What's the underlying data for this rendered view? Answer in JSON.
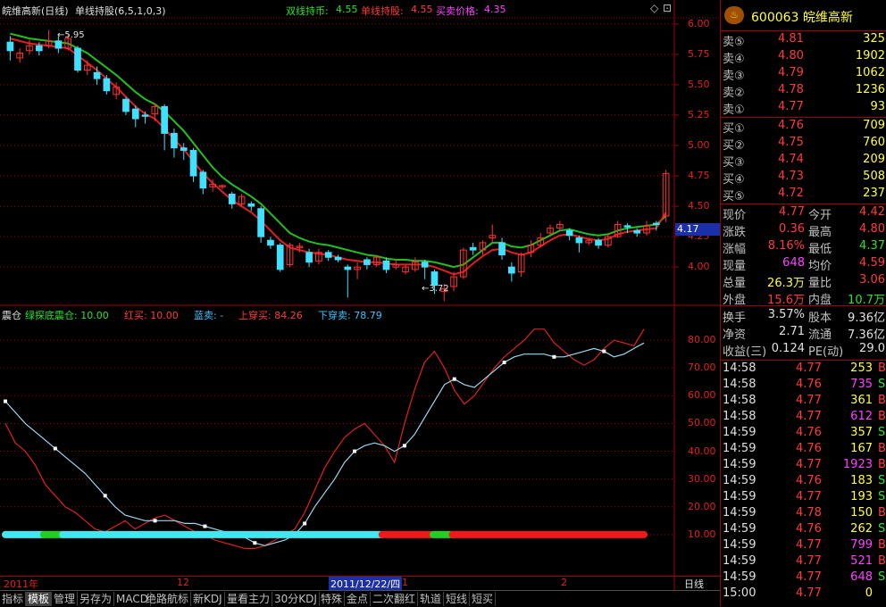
{
  "header": {
    "title": "皖维高新(日线)",
    "formula": "单线持股(6,5,1,0,3)",
    "stat1_label": "双线持币:",
    "stat1_value": "4.55",
    "stat2_label": "单线持股:",
    "stat2_value": "4.55",
    "stat3_label": "买卖价格:",
    "stat3_value": "4.35"
  },
  "price_axis": [
    "6.00",
    "5.75",
    "5.50",
    "5.25",
    "5.00",
    "4.75",
    "4.50",
    "4.25",
    "4.00"
  ],
  "price_marker": "4.17",
  "annotations": {
    "high": "5.95",
    "low": "3.72"
  },
  "indicator": {
    "name": "震仓",
    "items": [
      {
        "label": "绿探底震仓:",
        "value": "10.00",
        "color": "#2ee02e"
      },
      {
        "label": "红买:",
        "value": "10.00",
        "color": "#ff3a3a"
      },
      {
        "label": "蓝卖:",
        "value": "-",
        "color": "#40c0ff"
      },
      {
        "label": "上穿买:",
        "value": "84.26",
        "color": "#ff3a3a"
      },
      {
        "label": "下穿卖:",
        "value": "78.79",
        "color": "#40c0ff"
      }
    ],
    "axis": [
      "80.00",
      "70.00",
      "60.00",
      "50.00",
      "40.00",
      "30.00",
      "20.00",
      "10.00"
    ]
  },
  "datebar": {
    "year": "2011年",
    "m12": "12",
    "cursor_date": "2011/12/22/四",
    "m1": "1",
    "m2": "2",
    "period": "日线"
  },
  "tabs": [
    "指标",
    "模板",
    "管理",
    "另存为",
    "MACD",
    "绝路航标",
    "新KDJ",
    "量看主力",
    "30分KDJ",
    "特殊",
    "金点",
    "二次翻红",
    "轨道",
    "短线",
    "短买"
  ],
  "quote": {
    "code_name": "600063 皖维高新",
    "asks": [
      {
        "label": "卖⑤",
        "price": "4.81",
        "vol": "325"
      },
      {
        "label": "卖④",
        "price": "4.80",
        "vol": "1902"
      },
      {
        "label": "卖③",
        "price": "4.79",
        "vol": "1062"
      },
      {
        "label": "卖②",
        "price": "4.78",
        "vol": "1236"
      },
      {
        "label": "卖①",
        "price": "4.77",
        "vol": "93"
      }
    ],
    "bids": [
      {
        "label": "买①",
        "price": "4.76",
        "vol": "709"
      },
      {
        "label": "买②",
        "price": "4.75",
        "vol": "760"
      },
      {
        "label": "买③",
        "price": "4.74",
        "vol": "209"
      },
      {
        "label": "买④",
        "price": "4.73",
        "vol": "508"
      },
      {
        "label": "买⑤",
        "price": "4.72",
        "vol": "237"
      }
    ],
    "stats": [
      {
        "l1": "现价",
        "v1": "4.77",
        "c1": "red",
        "l2": "今开",
        "v2": "4.42",
        "c2": "red"
      },
      {
        "l1": "涨跌",
        "v1": "0.36",
        "c1": "red",
        "l2": "最高",
        "v2": "4.80",
        "c2": "red"
      },
      {
        "l1": "涨幅",
        "v1": "8.16%",
        "c1": "red",
        "l2": "最低",
        "v2": "4.37",
        "c2": "grn"
      },
      {
        "l1": "现量",
        "v1": "648",
        "c1": "mag",
        "l2": "均价",
        "v2": "4.59",
        "c2": "red"
      },
      {
        "l1": "总量",
        "v1": "26.3万",
        "c1": "yel",
        "l2": "量比",
        "v2": "3.06",
        "c2": "red"
      },
      {
        "l1": "外盘",
        "v1": "15.6万",
        "c1": "red",
        "l2": "内盘",
        "v2": "10.7万",
        "c2": "grn"
      }
    ],
    "stats2": [
      {
        "l1": "换手",
        "v1": "3.57%",
        "c1": "wht",
        "l2": "股本",
        "v2": "9.36亿",
        "c2": "wht"
      },
      {
        "l1": "净资",
        "v1": "2.71",
        "c1": "wht",
        "l2": "流通",
        "v2": "7.36亿",
        "c2": "wht"
      },
      {
        "l1": "收益(三)",
        "v1": "0.124",
        "c1": "wht",
        "l2": "PE(动)",
        "v2": "29.0",
        "c2": "wht"
      }
    ],
    "ticks": [
      {
        "t": "14:58",
        "p": "4.77",
        "v": "253",
        "s": "B",
        "vc": "yel"
      },
      {
        "t": "14:58",
        "p": "4.76",
        "v": "735",
        "s": "S",
        "vc": "mag"
      },
      {
        "t": "14:58",
        "p": "4.77",
        "v": "361",
        "s": "B",
        "vc": "yel"
      },
      {
        "t": "14:58",
        "p": "4.77",
        "v": "612",
        "s": "B",
        "vc": "mag"
      },
      {
        "t": "14:59",
        "p": "4.76",
        "v": "357",
        "s": "S",
        "vc": "yel"
      },
      {
        "t": "14:59",
        "p": "4.76",
        "v": "167",
        "s": "B",
        "vc": "yel"
      },
      {
        "t": "14:59",
        "p": "4.77",
        "v": "1923",
        "s": "B",
        "vc": "mag"
      },
      {
        "t": "14:59",
        "p": "4.76",
        "v": "183",
        "s": "S",
        "vc": "yel"
      },
      {
        "t": "14:59",
        "p": "4.77",
        "v": "193",
        "s": "S",
        "vc": "yel"
      },
      {
        "t": "14:59",
        "p": "4.78",
        "v": "150",
        "s": "B",
        "vc": "yel"
      },
      {
        "t": "14:59",
        "p": "4.76",
        "v": "262",
        "s": "S",
        "vc": "yel"
      },
      {
        "t": "14:59",
        "p": "4.77",
        "v": "799",
        "s": "B",
        "vc": "mag"
      },
      {
        "t": "14:59",
        "p": "4.77",
        "v": "521",
        "s": "B",
        "vc": "mag"
      },
      {
        "t": "14:59",
        "p": "4.77",
        "v": "648",
        "s": "S",
        "vc": "mag"
      },
      {
        "t": "15:00",
        "p": "4.77",
        "v": "0",
        "s": "",
        "vc": "yel"
      }
    ]
  },
  "colors": {
    "up": "#ff3030",
    "down": "#40e0ff",
    "grid": "#a00000",
    "ma_green": "#20c020",
    "ma_red": "#e02020"
  },
  "chart_data": {
    "type": "candlestick",
    "ylim": [
      3.7,
      6.05
    ],
    "candles": [
      [
        5.85,
        5.78,
        5.9,
        5.7
      ],
      [
        5.72,
        5.76,
        5.8,
        5.68
      ],
      [
        5.78,
        5.82,
        5.87,
        5.75
      ],
      [
        5.82,
        5.78,
        5.85,
        5.74
      ],
      [
        5.82,
        5.86,
        5.95,
        5.8
      ],
      [
        5.86,
        5.8,
        5.9,
        5.76
      ],
      [
        5.8,
        5.88,
        5.92,
        5.78
      ],
      [
        5.8,
        5.62,
        5.82,
        5.6
      ],
      [
        5.62,
        5.66,
        5.7,
        5.58
      ],
      [
        5.6,
        5.55,
        5.65,
        5.5
      ],
      [
        5.55,
        5.45,
        5.58,
        5.42
      ],
      [
        5.42,
        5.48,
        5.52,
        5.38
      ],
      [
        5.38,
        5.28,
        5.4,
        5.25
      ],
      [
        5.3,
        5.22,
        5.33,
        5.15
      ],
      [
        5.25,
        5.24,
        5.28,
        5.18
      ],
      [
        5.26,
        5.32,
        5.35,
        5.2
      ],
      [
        5.32,
        5.1,
        5.34,
        4.96
      ],
      [
        5.1,
        4.98,
        5.14,
        4.9
      ],
      [
        4.98,
        4.96,
        5.02,
        4.88
      ],
      [
        4.96,
        4.75,
        4.98,
        4.7
      ],
      [
        4.78,
        4.65,
        4.8,
        4.6
      ],
      [
        4.66,
        4.68,
        4.72,
        4.62
      ],
      [
        4.66,
        4.67,
        4.68,
        4.64
      ],
      [
        4.6,
        4.52,
        4.62,
        4.48
      ],
      [
        4.52,
        4.58,
        4.6,
        4.5
      ],
      [
        4.52,
        4.5,
        4.54,
        4.46
      ],
      [
        4.48,
        4.25,
        4.5,
        4.2
      ],
      [
        4.22,
        4.18,
        4.25,
        4.15
      ],
      [
        4.18,
        3.98,
        4.2,
        3.96
      ],
      [
        4.02,
        4.18,
        4.2,
        4.0
      ],
      [
        4.16,
        4.17,
        4.2,
        4.12
      ],
      [
        4.12,
        4.04,
        4.15,
        4.0
      ],
      [
        4.05,
        4.12,
        4.15,
        4.02
      ],
      [
        4.12,
        4.08,
        4.14,
        4.05
      ],
      [
        4.08,
        4.06,
        4.1,
        4.04
      ],
      [
        4.0,
        3.98,
        4.02,
        3.75
      ],
      [
        3.98,
        4.0,
        4.04,
        3.9
      ],
      [
        4.06,
        4.02,
        4.08,
        3.98
      ],
      [
        4.02,
        4.08,
        4.1,
        4.0
      ],
      [
        4.05,
        3.98,
        4.08,
        3.95
      ],
      [
        4.0,
        4.02,
        4.06,
        3.98
      ],
      [
        3.96,
        4.0,
        4.02,
        3.94
      ],
      [
        3.98,
        4.04,
        4.08,
        3.96
      ],
      [
        4.04,
        4.0,
        4.06,
        3.9
      ],
      [
        3.96,
        3.85,
        3.98,
        3.78
      ],
      [
        3.8,
        3.82,
        3.86,
        3.72
      ],
      [
        3.84,
        3.92,
        3.96,
        3.8
      ],
      [
        3.92,
        4.14,
        4.16,
        3.9
      ],
      [
        4.16,
        4.14,
        4.2,
        4.1
      ],
      [
        4.14,
        4.2,
        4.22,
        4.1
      ],
      [
        4.24,
        4.26,
        4.35,
        4.2
      ],
      [
        4.2,
        4.1,
        4.24,
        4.06
      ],
      [
        4.0,
        3.95,
        4.04,
        3.88
      ],
      [
        3.96,
        4.1,
        4.12,
        3.92
      ],
      [
        4.12,
        4.18,
        4.22,
        4.08
      ],
      [
        4.18,
        4.24,
        4.28,
        4.16
      ],
      [
        4.28,
        4.32,
        4.35,
        4.26
      ],
      [
        4.32,
        4.35,
        4.38,
        4.3
      ],
      [
        4.3,
        4.26,
        4.32,
        4.22
      ],
      [
        4.24,
        4.2,
        4.26,
        4.12
      ],
      [
        4.2,
        4.22,
        4.24,
        4.18
      ],
      [
        4.22,
        4.18,
        4.24,
        4.15
      ],
      [
        4.18,
        4.25,
        4.28,
        4.16
      ],
      [
        4.25,
        4.35,
        4.38,
        4.24
      ],
      [
        4.34,
        4.33,
        4.36,
        4.28
      ],
      [
        4.3,
        4.28,
        4.32,
        4.25
      ],
      [
        4.28,
        4.34,
        4.38,
        4.26
      ],
      [
        4.36,
        4.35,
        4.38,
        4.3
      ],
      [
        4.42,
        4.77,
        4.8,
        4.37
      ]
    ],
    "ma_green": [
      5.92,
      5.9,
      5.88,
      5.87,
      5.86,
      5.85,
      5.84,
      5.8,
      5.76,
      5.7,
      5.64,
      5.58,
      5.51,
      5.44,
      5.38,
      5.34,
      5.28,
      5.2,
      5.12,
      5.02,
      4.92,
      4.82,
      4.74,
      4.68,
      4.63,
      4.58,
      4.52,
      4.44,
      4.36,
      4.28,
      4.24,
      4.21,
      4.19,
      4.18,
      4.16,
      4.14,
      4.12,
      4.1,
      4.09,
      4.07,
      4.06,
      4.06,
      4.05,
      4.05,
      4.04,
      4.02,
      4.0,
      4.02,
      4.08,
      4.14,
      4.2,
      4.2,
      4.17,
      4.16,
      4.18,
      4.22,
      4.26,
      4.3,
      4.31,
      4.29,
      4.27,
      4.26,
      4.27,
      4.3,
      4.32,
      4.33,
      4.34,
      4.35,
      4.42
    ],
    "ma_red": [
      5.88,
      5.86,
      5.84,
      5.83,
      5.82,
      5.81,
      5.8,
      5.74,
      5.68,
      5.62,
      5.55,
      5.48,
      5.4,
      5.32,
      5.26,
      5.22,
      5.14,
      5.05,
      4.97,
      4.87,
      4.77,
      4.69,
      4.62,
      4.55,
      4.5,
      4.45,
      4.38,
      4.3,
      4.22,
      4.16,
      4.14,
      4.12,
      4.11,
      4.1,
      4.08,
      4.06,
      4.05,
      4.04,
      4.04,
      4.03,
      4.02,
      4.02,
      4.02,
      4.02,
      4.0,
      3.97,
      3.94,
      3.96,
      4.03,
      4.09,
      4.14,
      4.15,
      4.12,
      4.1,
      4.12,
      4.17,
      4.22,
      4.26,
      4.27,
      4.25,
      4.23,
      4.22,
      4.23,
      4.27,
      4.29,
      4.3,
      4.31,
      4.32,
      4.45
    ],
    "ind_red": [
      50,
      43,
      40,
      35,
      28,
      24,
      20,
      18,
      15,
      12,
      11,
      13,
      15,
      12,
      14,
      16,
      17,
      15,
      13,
      11,
      10,
      8,
      7,
      6,
      5,
      5,
      6,
      8,
      10,
      12,
      18,
      26,
      34,
      40,
      45,
      48,
      50,
      46,
      42,
      36,
      50,
      62,
      72,
      76,
      70,
      62,
      57,
      60,
      65,
      70,
      74,
      77,
      80,
      84,
      84,
      79,
      76,
      73,
      71,
      73,
      77,
      80,
      79,
      78,
      84
    ],
    "ind_blue": [
      58,
      54,
      50,
      47,
      44,
      41,
      38,
      35,
      32,
      28,
      24,
      20,
      17,
      16,
      15,
      15,
      15,
      15,
      14,
      14,
      13,
      12,
      11,
      10,
      9,
      7,
      6,
      7,
      8,
      10,
      14,
      20,
      25,
      30,
      36,
      40,
      42,
      43,
      42,
      40,
      42,
      46,
      52,
      58,
      64,
      66,
      64,
      63,
      66,
      69,
      72,
      74,
      75,
      75,
      75,
      74,
      74,
      75,
      76,
      77,
      76,
      74,
      75,
      77,
      79
    ],
    "ind_bar_segments": [
      {
        "from": 0,
        "to": 0.06,
        "color": "#40e8f0"
      },
      {
        "from": 0.06,
        "to": 0.09,
        "color": "#20d020"
      },
      {
        "from": 0.09,
        "to": 0.59,
        "color": "#40e8f0"
      },
      {
        "from": 0.59,
        "to": 0.67,
        "color": "#f01818"
      },
      {
        "from": 0.67,
        "to": 0.7,
        "color": "#20d020"
      },
      {
        "from": 0.7,
        "to": 1,
        "color": "#f01818"
      }
    ]
  }
}
